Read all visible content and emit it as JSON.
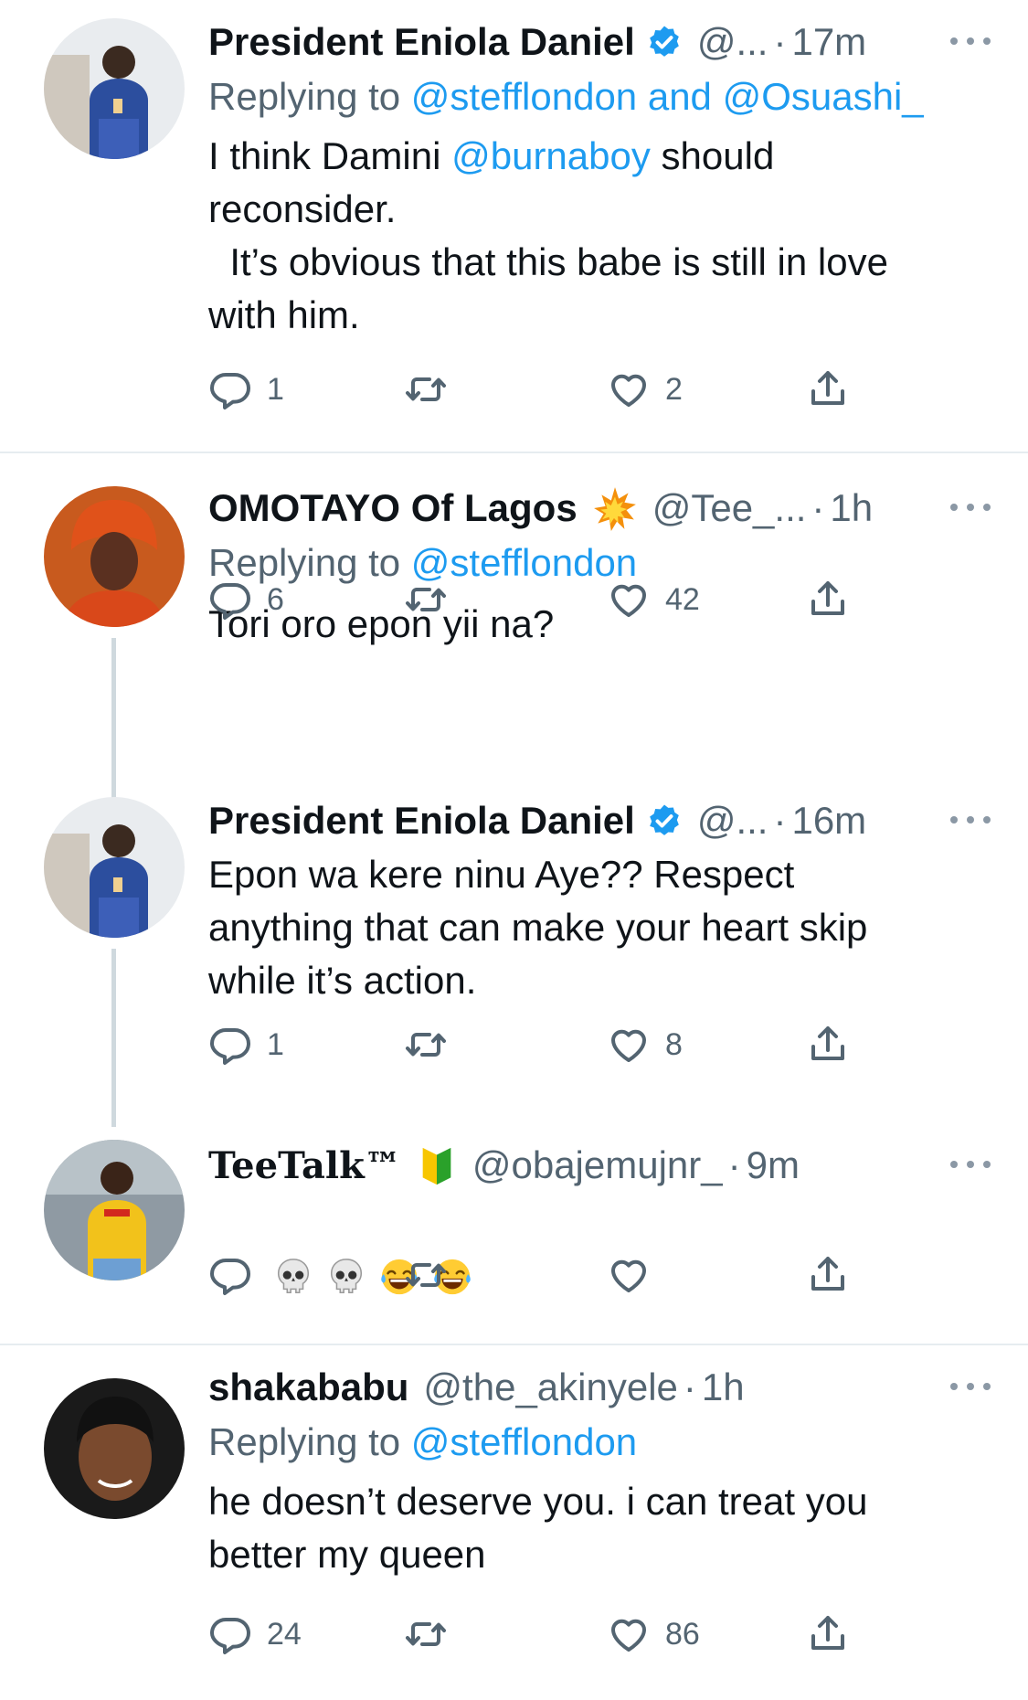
{
  "tweets": [
    {
      "name": "President Eniola Daniel",
      "handle": "@...",
      "time": "17m",
      "replying_prefix": "Replying to ",
      "replying_to_1": "@stefflondon",
      "replying_and": " and ",
      "replying_to_2": "@Osuashi_",
      "text_1": "I think Damini ",
      "text_mention": "@burnaboy",
      "text_2": " should\nreconsider.\n  It’s obvious that this babe is still in love\nwith him.",
      "replies": "1",
      "retweets": "",
      "likes": "2"
    },
    {
      "name": "OMOTAYO Of Lagos",
      "handle": "@Tee_...",
      "time": "1h",
      "replying_prefix": "Replying to ",
      "replying_to_1": "@stefflondon",
      "text": "Tori oro epon yii na?",
      "replies": "6",
      "retweets": "",
      "likes": "42"
    },
    {
      "name": "President Eniola Daniel",
      "handle": "@...",
      "time": "16m",
      "text": "Epon wa kere ninu Aye?? Respect\nanything that can make your heart skip\nwhile it’s action.",
      "replies": "1",
      "retweets": "",
      "likes": "8"
    },
    {
      "name": "TeeTalk™",
      "handle": "@obajemujnr_",
      "time": "9m",
      "emojis": [
        "skull",
        "skull",
        "joy",
        "joy"
      ],
      "replies": "",
      "retweets": "",
      "likes": ""
    },
    {
      "name": "shakababu",
      "handle": "@the_akinyele",
      "time": "1h",
      "replying_prefix": "Replying to ",
      "replying_to_1": "@stefflondon",
      "text": "he doesn’t deserve you. i can treat you\nbetter my queen",
      "replies": "24",
      "retweets": "",
      "likes": "86"
    }
  ],
  "colors": {
    "link": "#1d9bf0",
    "secondary_text": "#536471",
    "verified": "#1d9bf0",
    "divider": "#e6ecf0"
  },
  "icons": [
    "verified-badge-icon",
    "collision-emoji-icon",
    "beginner-emoji-icon",
    "reply-icon",
    "retweet-icon",
    "like-icon",
    "share-icon",
    "more-icon"
  ]
}
